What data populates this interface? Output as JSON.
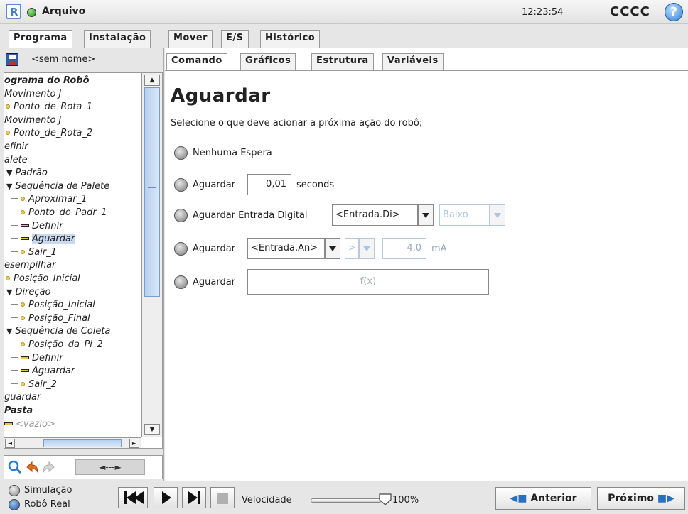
{
  "header": {
    "app_title": "Arquivo",
    "clock": "12:23:54",
    "robot_name": "CCCC",
    "help_label": "?"
  },
  "main_tabs": [
    {
      "label": "Programa",
      "active": true
    },
    {
      "label": "Instalação",
      "active": false
    },
    {
      "label": "Mover",
      "active": false
    },
    {
      "label": "E/S",
      "active": false
    },
    {
      "label": "Histórico",
      "active": false
    }
  ],
  "file": {
    "name": "<sem nome>"
  },
  "tree": [
    {
      "label": "ograma do Robô",
      "kind": "bold"
    },
    {
      "label": "Movimento J",
      "kind": "plain"
    },
    {
      "label": "Ponto_de_Rota_1",
      "kind": "wp"
    },
    {
      "label": "Movimento J",
      "kind": "plain"
    },
    {
      "label": "Ponto_de_Rota_2",
      "kind": "wp"
    },
    {
      "label": "efinir",
      "kind": "plain"
    },
    {
      "label": "alete",
      "kind": "plain"
    },
    {
      "label": "Padrão",
      "kind": "tri"
    },
    {
      "label": "Sequência de Palete",
      "kind": "tri"
    },
    {
      "label": "Aproximar_1",
      "kind": "wp-ln"
    },
    {
      "label": "Ponto_do_Padr_1",
      "kind": "wp-ln"
    },
    {
      "label": "Definir",
      "kind": "bar-ln"
    },
    {
      "label": "Aguardar",
      "kind": "bar-ln-sel"
    },
    {
      "label": "Sair_1",
      "kind": "wp-ln"
    },
    {
      "label": "esempilhar",
      "kind": "plain"
    },
    {
      "label": "Posição_Inicial",
      "kind": "wp"
    },
    {
      "label": "Direção",
      "kind": "tri"
    },
    {
      "label": "Posição_Inicial",
      "kind": "wp-ln"
    },
    {
      "label": "Posição_Final",
      "kind": "wp-ln"
    },
    {
      "label": "Sequência de Coleta",
      "kind": "tri"
    },
    {
      "label": "Posição_da_Pi_2",
      "kind": "wp-ln"
    },
    {
      "label": "Definir",
      "kind": "bar-ln"
    },
    {
      "label": "Aguardar",
      "kind": "bar-ln"
    },
    {
      "label": "Sair_2",
      "kind": "wp-ln"
    },
    {
      "label": "guardar",
      "kind": "plain"
    },
    {
      "label": "Pasta",
      "kind": "bold"
    },
    {
      "label": "<vazio>",
      "kind": "bar"
    }
  ],
  "tools": {
    "arrows_label": "◄---►"
  },
  "sub_tabs": [
    {
      "label": "Comando",
      "active": true
    },
    {
      "label": "Gráficos",
      "active": false
    },
    {
      "label": "Estrutura",
      "active": false
    },
    {
      "label": "Variáveis",
      "active": false
    }
  ],
  "command": {
    "title": "Aguardar",
    "description": "Selecione o que deve acionar a próxima ação do robô;",
    "opt_none": "Nenhuma Espera",
    "opt_wait_label": "Aguardar",
    "opt_wait_value": "0,01",
    "opt_wait_unit": "seconds",
    "opt_digital_label": "Aguardar Entrada Digital",
    "opt_digital_input": "<Entrada.Di>",
    "opt_digital_state": "Baixo",
    "opt_analog_label": "Aguardar",
    "opt_analog_input": "<Entrada.An>",
    "opt_analog_op": ">",
    "opt_analog_value": "4,0",
    "opt_analog_unit": "mA",
    "opt_expr_label": "Aguardar",
    "opt_expr_placeholder": "f(x)"
  },
  "footer": {
    "sim_label": "Simulação",
    "real_label": "Robô Real",
    "speed_label": "Velocidade",
    "speed_value": "100%",
    "speed_fraction": 1.0,
    "prev_label": "Anterior",
    "next_label": "Próximo"
  }
}
